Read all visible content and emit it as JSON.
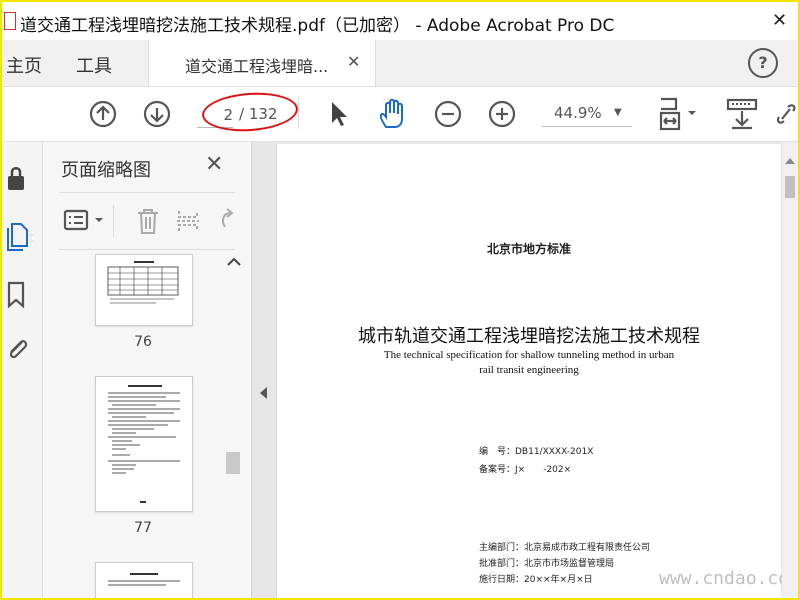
{
  "window": {
    "title": "道交通工程浅埋暗挖法施工技术规程.pdf（已加密） - Adobe Acrobat Pro DC"
  },
  "tabs": {
    "home": "主页",
    "tools": "工具",
    "document": "道交通工程浅埋暗...",
    "help": "?"
  },
  "toolbar": {
    "current_page": "2",
    "total_pages": "/ 132",
    "zoom": "44.9%"
  },
  "panel": {
    "title": "页面缩略图",
    "thumbnails": [
      {
        "number": "76"
      },
      {
        "number": "77"
      }
    ]
  },
  "document": {
    "standard": "北京市地方标准",
    "title": "城市轨道交通工程浅埋暗挖法施工技术规程",
    "english_title": "The technical specification for shallow tunneling method in urban rail transit engineering",
    "code": "编　号：DB11/XXXX-201X",
    "record": "备案号：J×　　-202×",
    "editor": "主编部门：北京易成市政工程有限责任公司",
    "approver": "批准部门：北京市市场监督管理局",
    "date": "施行日期：20××年×月×日"
  },
  "watermark": "www.cndao.com",
  "colors": {
    "accent_blue": "#1b6ac9",
    "annotation_red": "#d11111",
    "frame_yellow": "#f2e600"
  }
}
